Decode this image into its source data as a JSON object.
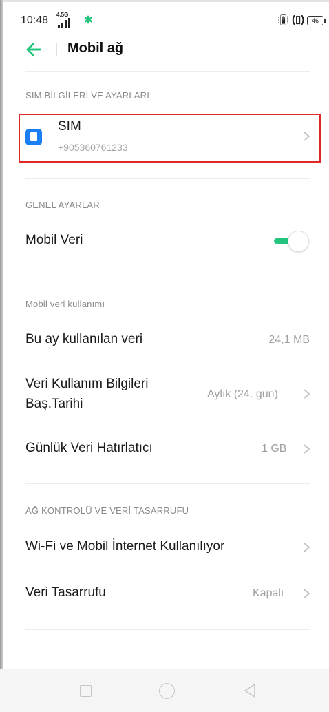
{
  "status_bar": {
    "time": "10:48",
    "network_type": "4.5G",
    "battery": "46",
    "icons": [
      "signal-icon",
      "app-notification-icon",
      "vibrate-icon",
      "battery-icon"
    ]
  },
  "header": {
    "title": "Mobil ağ",
    "back_icon": "arrow-left-icon",
    "accent_color": "#23c47e"
  },
  "sim_section": {
    "title": "SIM BİLGİLERİ VE AYARLARI",
    "sim": {
      "label": "SIM",
      "number": "+905360761233",
      "icon": "sim-card-icon",
      "icon_color": "#1a7ff4"
    }
  },
  "general_section": {
    "title": "GENEL AYARLAR",
    "mobile_data": {
      "label": "Mobil Veri",
      "enabled": true
    }
  },
  "usage_section": {
    "title": "Mobil veri kullanımı",
    "items": [
      {
        "label": "Bu ay kullanılan veri",
        "value": "24,1 MB"
      },
      {
        "label_line1": "Veri Kullanım Bilgileri",
        "label_line2": "Baş.Tarihi",
        "value": "Aylık (24. gün)"
      },
      {
        "label": "Günlük Veri Hatırlatıcı",
        "value": "1 GB"
      }
    ]
  },
  "network_section": {
    "title": "AĞ KONTROLÜ VE VERİ TASARRUFU",
    "items": [
      {
        "label": "Wi-Fi ve Mobil İnternet Kullanılıyor"
      },
      {
        "label": "Veri Tasarrufu",
        "value": "Kapalı"
      }
    ]
  },
  "nav_bar": {
    "buttons": [
      "recent-apps-icon",
      "home-icon",
      "back-triangle-icon"
    ]
  }
}
